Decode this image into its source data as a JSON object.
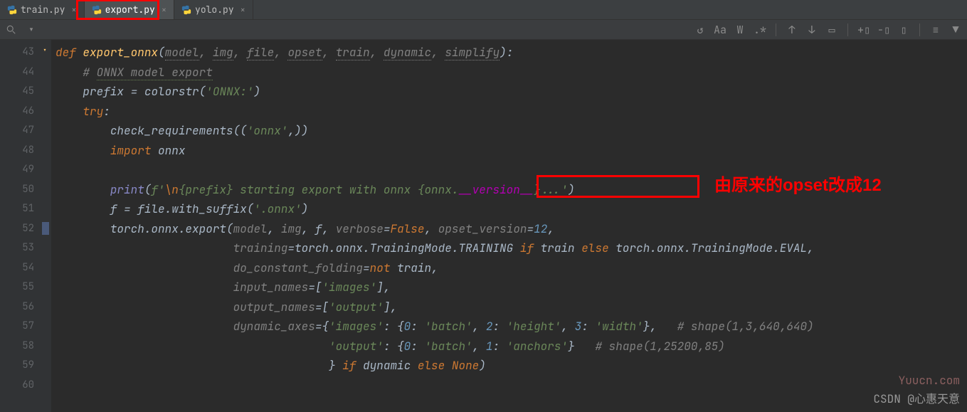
{
  "tabs": [
    {
      "label": "train.py"
    },
    {
      "label": "export.py"
    },
    {
      "label": "yolo.py"
    }
  ],
  "search": {
    "placeholder": ""
  },
  "lines": {
    "start": 43,
    "end": 60
  },
  "code": {
    "l43": {
      "def": "def",
      "name": "export_onnx",
      "p1": "model",
      "p2": "img",
      "p3": "file",
      "p4": "opset",
      "p5": "train",
      "p6": "dynamic",
      "p7": "simplify"
    },
    "l44": {
      "hash": "# ",
      "comment": "ONNX model export"
    },
    "l45": {
      "lhs": "prefix",
      "eq": "=",
      "fn": "colorstr",
      "arg": "'ONNX:'"
    },
    "l46": {
      "try": "try"
    },
    "l47": {
      "fn": "check_requirements",
      "arg": "'onnx'"
    },
    "l48": {
      "imp": "import",
      "mod": "onnx"
    },
    "l50": {
      "print": "print",
      "fs": "f'",
      "t1": "\\n",
      "pre": "{prefix}",
      "t2": " starting export with onnx ",
      "ver": "{onnx.",
      "ver2": "__version__",
      "ver3": "}",
      "t3": "...'"
    },
    "l51": {
      "lhs": "f",
      "eq": "=",
      "rhs": "file.with_suffix",
      "arg": "'.onnx'"
    },
    "l52": {
      "call": "torch.onnx.",
      "fnm": "export",
      "p1": "model",
      "p2": "img",
      "p3": "f",
      "k1": "verbose",
      "v1": "False",
      "k2": "opset_version",
      "v2": "12"
    },
    "l53": {
      "k": "training",
      "r1": "torch.onnx.TrainingMode.TRAINING",
      "if": "if",
      "c": "train",
      "else": "else",
      "r2": "torch.onnx.TrainingMode.EVAL"
    },
    "l54": {
      "k": "do_constant_folding",
      "not": "not",
      "v": "train"
    },
    "l55": {
      "k": "input_names",
      "v": "'images'"
    },
    "l56": {
      "k": "output_names",
      "v": "'output'"
    },
    "l57": {
      "k": "dynamic_axes",
      "kk1": "'images'",
      "n0": "0",
      "v0": "'batch'",
      "n2": "2",
      "v2": "'height'",
      "n3": "3",
      "v3": "'width'",
      "comment": "# shape(1,3,640,640)"
    },
    "l58": {
      "kk2": "'output'",
      "n0": "0",
      "v0": "'batch'",
      "n1": "1",
      "v1": "'anchors'",
      "comment": "# shape(1,25200,85)"
    },
    "l59": {
      "brace": "}",
      "if": "if",
      "c": "dynamic",
      "else": "else",
      "none": "None"
    }
  },
  "annotation": "由原来的opset改成12",
  "watermark1": "Yuucn.com",
  "watermark2": "CSDN @心惠天意"
}
